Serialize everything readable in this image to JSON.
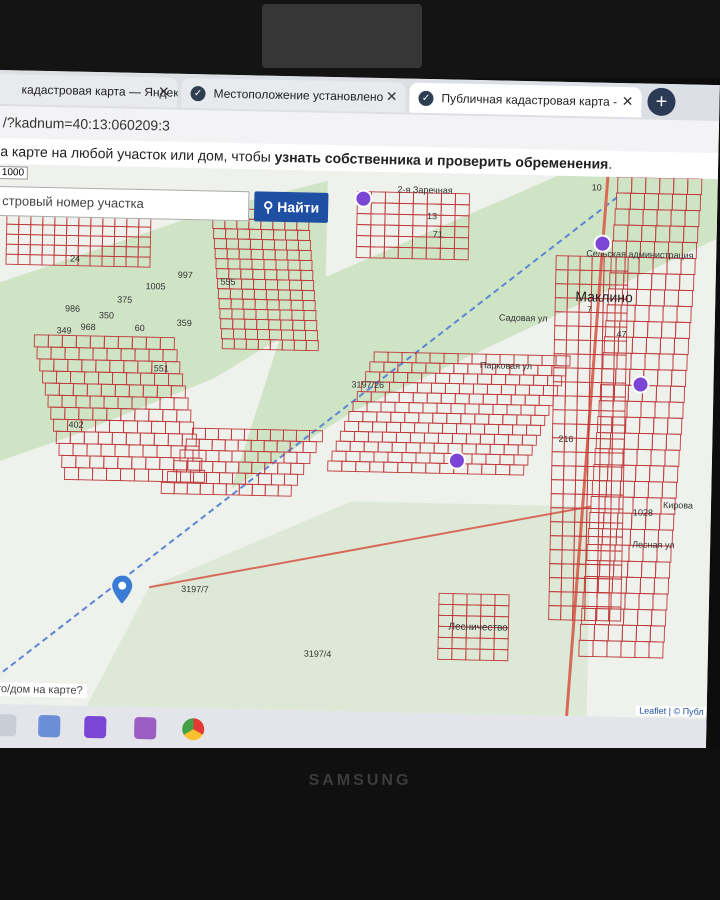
{
  "browser": {
    "tabs": [
      {
        "label": "кадастровая карта — Яндекс: на",
        "active": false
      },
      {
        "label": "Местоположение установлено",
        "active": false
      },
      {
        "label": "Публичная кадастровая карта -",
        "active": true
      }
    ],
    "address": "/?kadnum=40:13:060209:3"
  },
  "page": {
    "hint_prefix": "а карте на любой участок или дом, чтобы ",
    "hint_bold": "узнать собственника и проверить обременения",
    "hint_suffix": "."
  },
  "map": {
    "scale_label": "1000",
    "search_placeholder": "стровый номер участка",
    "find_button": "Найти",
    "place_names": [
      "Маклино",
      "Лесничество"
    ],
    "parcel_labels": [
      "555",
      "359",
      "375",
      "350",
      "968",
      "986",
      "1005",
      "997",
      "60",
      "402",
      "349",
      "551",
      "24",
      "10",
      "13",
      "71",
      "216",
      "7",
      "47",
      "3197/7",
      "3197/4",
      "3197/26",
      "1028"
    ],
    "street_labels": [
      "Парковая ул",
      "Кирова",
      "Лесная ул",
      "2-я Заречная",
      "Садовая ул"
    ],
    "admin_label": "Сельская администрация",
    "question_link": "кто/дом на карте?",
    "attribution": "Leaflet | © Публ"
  },
  "device": {
    "brand": "SAMSUNG"
  },
  "colors": {
    "parcel_line": "#c0393b",
    "road": "#d86a5a",
    "forest": "#cfe3c5",
    "accent": "#1e4fa3"
  }
}
